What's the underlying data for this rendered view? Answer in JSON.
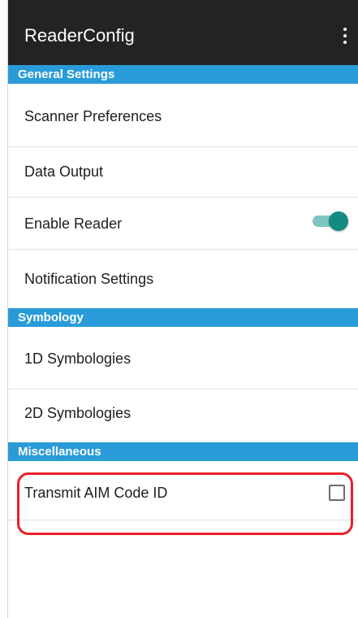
{
  "app_bar": {
    "title": "ReaderConfig",
    "menu_icon": "more-vert-icon"
  },
  "sections": {
    "general": "General Settings",
    "symbology": "Symbology",
    "miscellaneous": "Miscellaneous"
  },
  "items": {
    "scanner_preferences": "Scanner Preferences",
    "data_output": "Data Output",
    "enable_reader": "Enable Reader",
    "notification_settings": "Notification Settings",
    "symbologies_1d": "1D Symbologies",
    "symbologies_2d": "2D Symbologies",
    "transmit_aim_code_id": "Transmit AIM Code ID"
  },
  "states": {
    "enable_reader_on": true,
    "transmit_aim_code_id_checked": false
  },
  "colors": {
    "app_bar": "#232323",
    "section_header": "#2a9bd9",
    "toggle_on": "#138a82",
    "highlight": "#e8202a"
  }
}
